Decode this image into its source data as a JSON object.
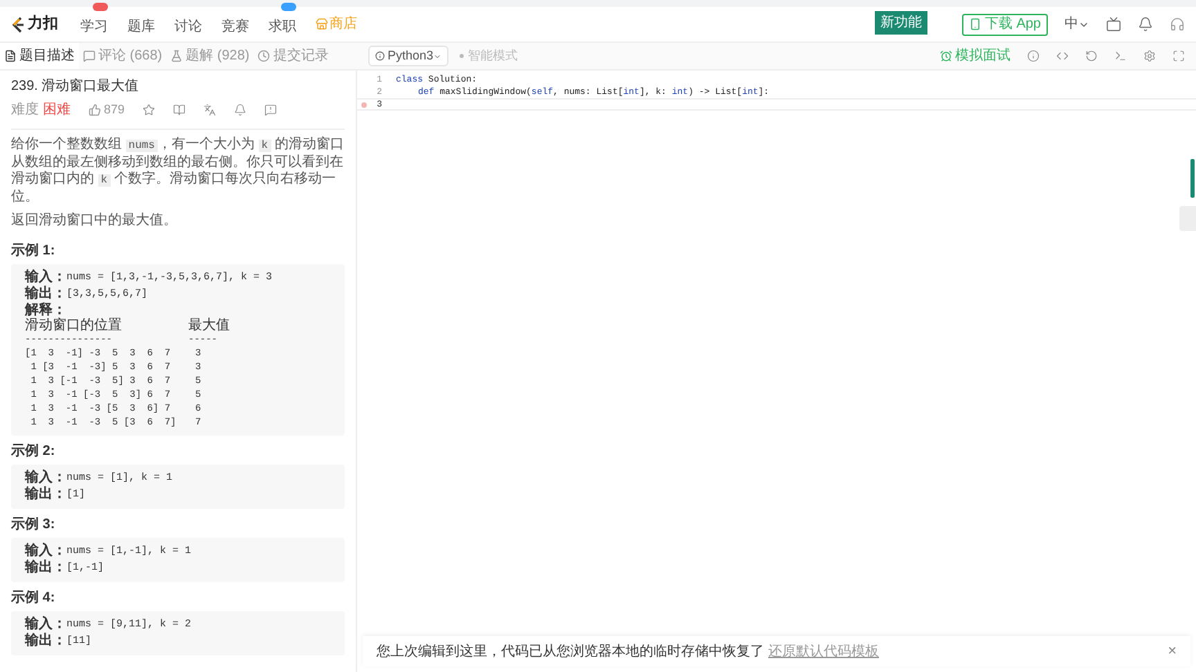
{
  "nav": {
    "logo": "力扣",
    "items": [
      {
        "label": "学习",
        "color": "#f05a5a"
      },
      {
        "label": "题库"
      },
      {
        "label": "讨论"
      },
      {
        "label": "竞赛"
      },
      {
        "label": "求职",
        "color": "#3aa0ff"
      }
    ],
    "store": "商店",
    "new_feature": "新功能",
    "download": "下载 App",
    "lang": "中"
  },
  "tabs": [
    {
      "label": "题目描述",
      "selected": true
    },
    {
      "label": "评论 (668)",
      "selected": false
    },
    {
      "label": "题解 (928)",
      "selected": false
    },
    {
      "label": "提交记录",
      "selected": false
    }
  ],
  "editor_toolbar": {
    "language": "Python3",
    "smart_mode": "智能模式",
    "mock_interview": "模拟面试"
  },
  "problem": {
    "title": "239. 滑动窗口最大值",
    "difficulty_label": "难度",
    "difficulty": "困难",
    "likes": "879",
    "paragraphs": [
      [
        {
          "text": "给你一个整数数组 "
        },
        {
          "text": "nums",
          "code": true
        },
        {
          "text": "，有一个大小为 "
        },
        {
          "text": "k",
          "code": true
        },
        {
          "text": " 的滑动窗口从数组的最左侧移动到数组的最右侧。你只可以看到在滑动窗口内的 "
        },
        {
          "text": "k",
          "code": true
        },
        {
          "text": " 个数字。滑动窗口每次只向右移动一位。"
        }
      ],
      [
        {
          "text": "返回滑动窗口中的最大值。"
        }
      ]
    ],
    "examples": [
      {
        "title": "示例 1:",
        "input_label": "输入：",
        "input": "nums = [1,3,-1,-3,5,3,6,7], k = 3",
        "output_label": "输出：",
        "output": "[3,3,5,5,6,7]",
        "explanation_label": "解释：",
        "table_header": [
          "滑动窗口的位置",
          "最大值"
        ],
        "table_rule": [
          "---------------",
          "-----"
        ],
        "table_rows": [
          [
            "[1  3  -1] -3  5  3  6  7",
            "3"
          ],
          [
            " 1 [3  -1  -3] 5  3  6  7",
            "3"
          ],
          [
            " 1  3 [-1  -3  5] 3  6  7",
            "5"
          ],
          [
            " 1  3  -1 [-3  5  3] 6  7",
            "5"
          ],
          [
            " 1  3  -1  -3 [5  3  6] 7",
            "6"
          ],
          [
            " 1  3  -1  -3  5 [3  6  7]",
            "7"
          ]
        ]
      },
      {
        "title": "示例 2:",
        "input_label": "输入：",
        "input": "nums = [1], k = 1",
        "output_label": "输出：",
        "output": "[1]"
      },
      {
        "title": "示例 3:",
        "input_label": "输入：",
        "input": "nums = [1,-1], k = 1",
        "output_label": "输出：",
        "output": "[1,-1]"
      },
      {
        "title": "示例 4:",
        "input_label": "输入：",
        "input": "nums = [9,11], k = 2",
        "output_label": "输出：",
        "output": "[11]"
      }
    ]
  },
  "code": [
    {
      "number": "1",
      "current": false,
      "breakpoint": false,
      "tokens": [
        {
          "t": "class",
          "kind": "keyword"
        },
        {
          "t": " Solution:",
          "kind": "plain"
        }
      ]
    },
    {
      "number": "2",
      "current": false,
      "breakpoint": false,
      "indented": true,
      "tokens": [
        {
          "t": "def",
          "kind": "keyword"
        },
        {
          "t": " maxSlidingWindow(",
          "kind": "plain"
        },
        {
          "t": "self",
          "kind": "keyword"
        },
        {
          "t": ", nums: List[",
          "kind": "plain"
        },
        {
          "t": "int",
          "kind": "keyword"
        },
        {
          "t": "], k: ",
          "kind": "plain"
        },
        {
          "t": "int",
          "kind": "keyword"
        },
        {
          "t": ") -> List[",
          "kind": "plain"
        },
        {
          "t": "int",
          "kind": "keyword"
        },
        {
          "t": "]:",
          "kind": "plain"
        }
      ]
    },
    {
      "number": "3",
      "current": true,
      "breakpoint": true
    }
  ],
  "notice": {
    "text": "您上次编辑到这里，代码已从您浏览器本地的临时存储中恢复了",
    "link": "还原默认代码模板",
    "close": "×"
  }
}
